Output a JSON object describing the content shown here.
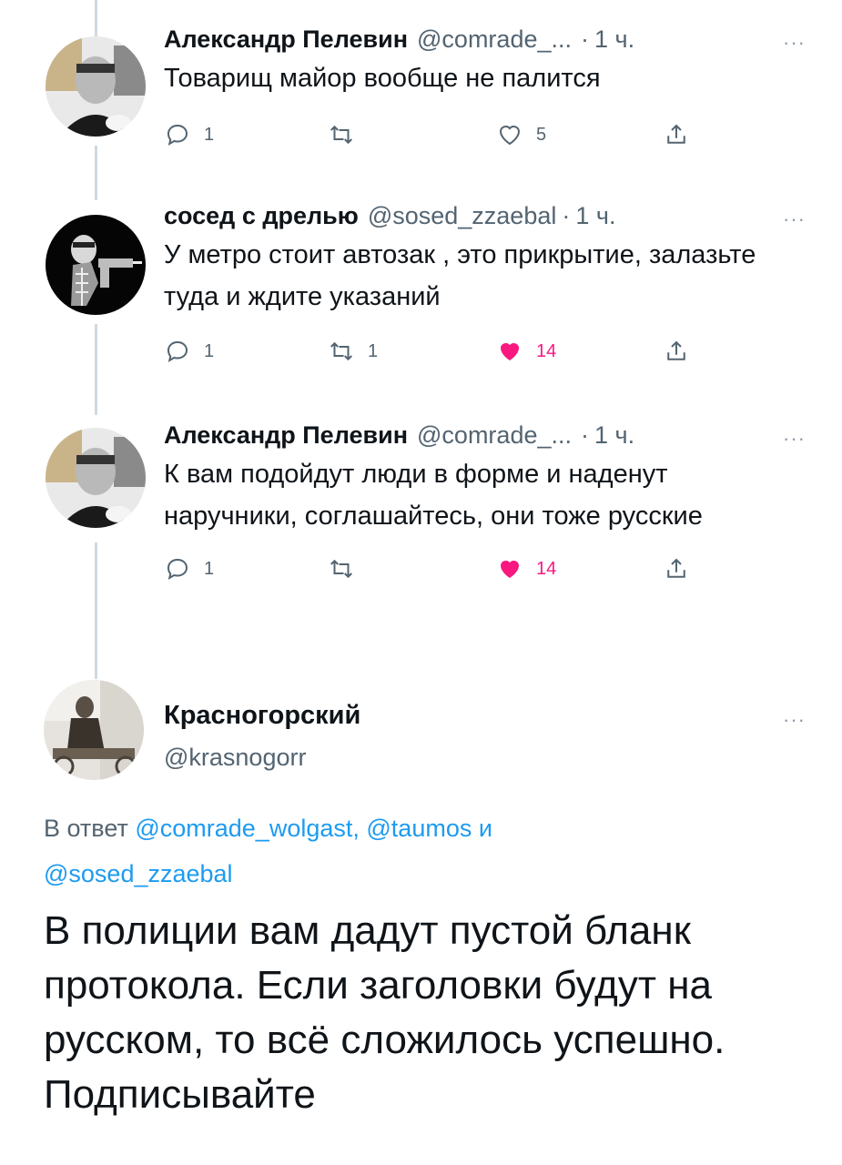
{
  "replies": [
    {
      "name": "Александр Пелевин",
      "handle": "@comrade_...",
      "time": "1 ч.",
      "text": "Товарищ майор вообще не палится",
      "reply_count": "1",
      "retweet_count": "",
      "like_count": "5",
      "liked": false
    },
    {
      "name": "сосед с дрелью",
      "handle": "@sosed_zzaebal",
      "time": "1 ч.",
      "text": "У метро стоит автозак , это прикрытие, залазьте туда и ждите указаний",
      "reply_count": "1",
      "retweet_count": "1",
      "like_count": "14",
      "liked": true
    },
    {
      "name": "Александр Пелевин",
      "handle": "@comrade_...",
      "time": "1 ч.",
      "text": "К вам подойдут люди в форме и наденут наручники, соглашайтесь, они тоже русские",
      "reply_count": "1",
      "retweet_count": "",
      "like_count": "14",
      "liked": true
    }
  ],
  "main_tweet": {
    "name": "Красногорский",
    "handle": "@krasnogorr",
    "replying_prefix": "В ответ",
    "mention_1": "@comrade_wolgast,",
    "mention_2": "@taumos",
    "and_word": "и",
    "mention_3": "@sosed_zzaebal",
    "text": "В полиции вам дадут пустой бланк протокола. Если заголовки будут на русском, то всё сложилось успешно. Подписывайте"
  },
  "more_glyph": "···",
  "dot_glyph": "·",
  "colors": {
    "like": "#f91880",
    "link": "#1d9bf0",
    "secondary_text": "#536471",
    "thread_line": "#cfd9de"
  },
  "icons": [
    "reply-icon",
    "retweet-icon",
    "like-icon",
    "share-icon",
    "more-icon"
  ]
}
